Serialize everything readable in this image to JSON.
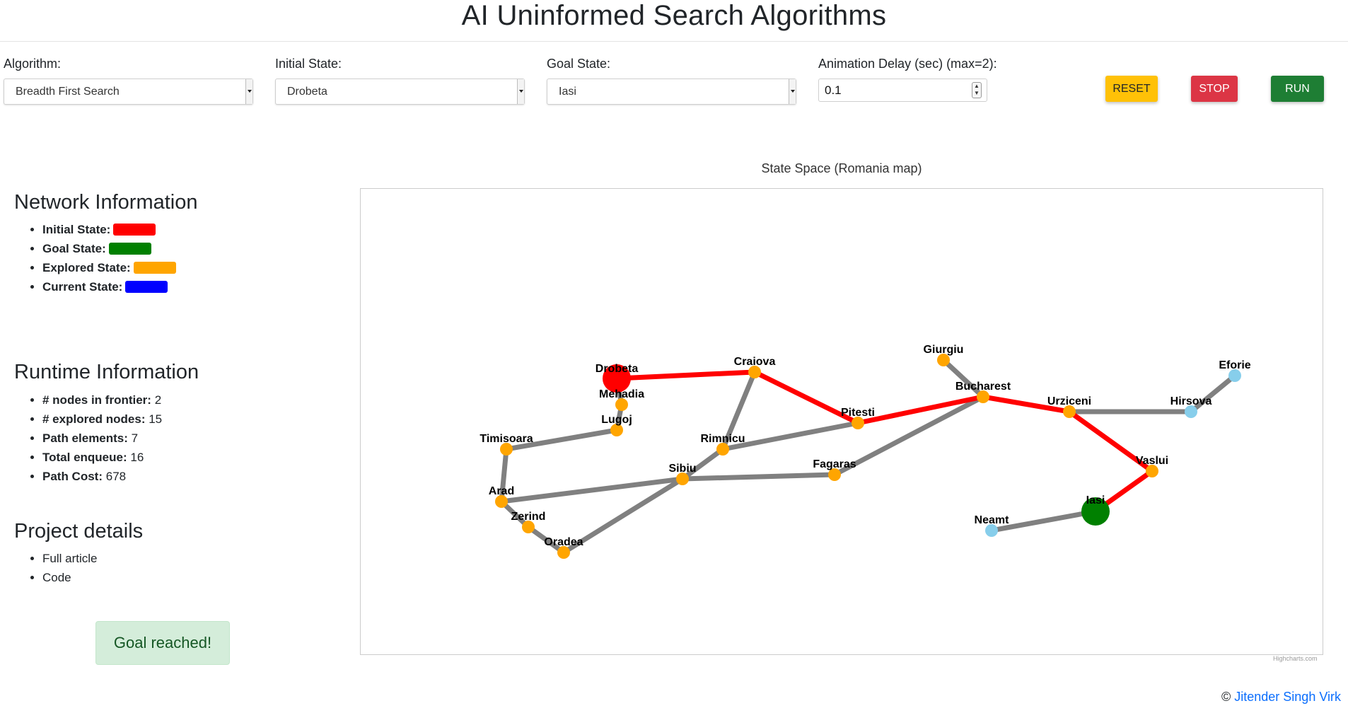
{
  "header": {
    "title": "AI Uninformed Search Algorithms"
  },
  "controls": {
    "algorithm_label": "Algorithm:",
    "algorithm_value": "Breadth First Search",
    "initial_label": "Initial State:",
    "initial_value": "Drobeta",
    "goal_label": "Goal State:",
    "goal_value": "Iasi",
    "delay_label": "Animation Delay (sec) (max=2):",
    "delay_value": "0.1",
    "reset_label": "RESET",
    "stop_label": "STOP",
    "run_label": "RUN"
  },
  "network_info": {
    "title": "Network Information",
    "items": [
      {
        "label": "Initial State:",
        "color": "#ff0000"
      },
      {
        "label": "Goal State:",
        "color": "#008000"
      },
      {
        "label": "Explored State:",
        "color": "#ffa500"
      },
      {
        "label": "Current State:",
        "color": "#0000ff"
      }
    ]
  },
  "runtime_info": {
    "title": "Runtime Information",
    "items": [
      {
        "label": "# nodes in frontier:",
        "value": "2"
      },
      {
        "label": "# explored nodes:",
        "value": "15"
      },
      {
        "label": "Path elements:",
        "value": "7"
      },
      {
        "label": "Total enqueue:",
        "value": "16"
      },
      {
        "label": "Path Cost:",
        "value": "678"
      }
    ]
  },
  "project": {
    "title": "Project details",
    "links": [
      "Full article",
      "Code"
    ]
  },
  "status_message": "Goal reached!",
  "map": {
    "title": "State Space (Romania map)",
    "credit": "Highcharts.com",
    "colors": {
      "path": "#ff0000",
      "edge": "#808080",
      "explored": "#ffa500",
      "unexplored": "#87ceeb",
      "initial": "#ff0000",
      "goal": "#008000"
    },
    "nodes": [
      {
        "name": "Drobeta",
        "state": "initial"
      },
      {
        "name": "Mehadia",
        "state": "explored"
      },
      {
        "name": "Lugoj",
        "state": "explored"
      },
      {
        "name": "Timisoara",
        "state": "explored"
      },
      {
        "name": "Arad",
        "state": "explored"
      },
      {
        "name": "Zerind",
        "state": "explored"
      },
      {
        "name": "Oradea",
        "state": "explored"
      },
      {
        "name": "Sibiu",
        "state": "explored"
      },
      {
        "name": "Rimnicu",
        "state": "explored"
      },
      {
        "name": "Craiova",
        "state": "explored"
      },
      {
        "name": "Pitesti",
        "state": "explored"
      },
      {
        "name": "Fagaras",
        "state": "explored"
      },
      {
        "name": "Bucharest",
        "state": "explored"
      },
      {
        "name": "Giurgiu",
        "state": "explored"
      },
      {
        "name": "Urziceni",
        "state": "explored"
      },
      {
        "name": "Hirsova",
        "state": "unexplored"
      },
      {
        "name": "Eforie",
        "state": "unexplored"
      },
      {
        "name": "Vaslui",
        "state": "explored"
      },
      {
        "name": "Iasi",
        "state": "goal"
      },
      {
        "name": "Neamt",
        "state": "unexplored"
      }
    ],
    "edges": [
      {
        "from": "Drobeta",
        "to": "Craiova",
        "path": true
      },
      {
        "from": "Craiova",
        "to": "Pitesti",
        "path": true
      },
      {
        "from": "Pitesti",
        "to": "Bucharest",
        "path": true
      },
      {
        "from": "Bucharest",
        "to": "Urziceni",
        "path": true
      },
      {
        "from": "Urziceni",
        "to": "Vaslui",
        "path": true
      },
      {
        "from": "Vaslui",
        "to": "Iasi",
        "path": true
      },
      {
        "from": "Drobeta",
        "to": "Mehadia",
        "path": false
      },
      {
        "from": "Mehadia",
        "to": "Lugoj",
        "path": false
      },
      {
        "from": "Lugoj",
        "to": "Timisoara",
        "path": false
      },
      {
        "from": "Timisoara",
        "to": "Arad",
        "path": false
      },
      {
        "from": "Arad",
        "to": "Zerind",
        "path": false
      },
      {
        "from": "Zerind",
        "to": "Oradea",
        "path": false
      },
      {
        "from": "Arad",
        "to": "Sibiu",
        "path": false
      },
      {
        "from": "Oradea",
        "to": "Sibiu",
        "path": false
      },
      {
        "from": "Sibiu",
        "to": "Rimnicu",
        "path": false
      },
      {
        "from": "Sibiu",
        "to": "Fagaras",
        "path": false
      },
      {
        "from": "Rimnicu",
        "to": "Craiova",
        "path": false
      },
      {
        "from": "Rimnicu",
        "to": "Pitesti",
        "path": false
      },
      {
        "from": "Fagaras",
        "to": "Bucharest",
        "path": false
      },
      {
        "from": "Bucharest",
        "to": "Giurgiu",
        "path": false
      },
      {
        "from": "Urziceni",
        "to": "Hirsova",
        "path": false
      },
      {
        "from": "Hirsova",
        "to": "Eforie",
        "path": false
      },
      {
        "from": "Iasi",
        "to": "Neamt",
        "path": false
      }
    ]
  },
  "footer": {
    "copyright": "©",
    "author": "Jitender Singh Virk"
  }
}
